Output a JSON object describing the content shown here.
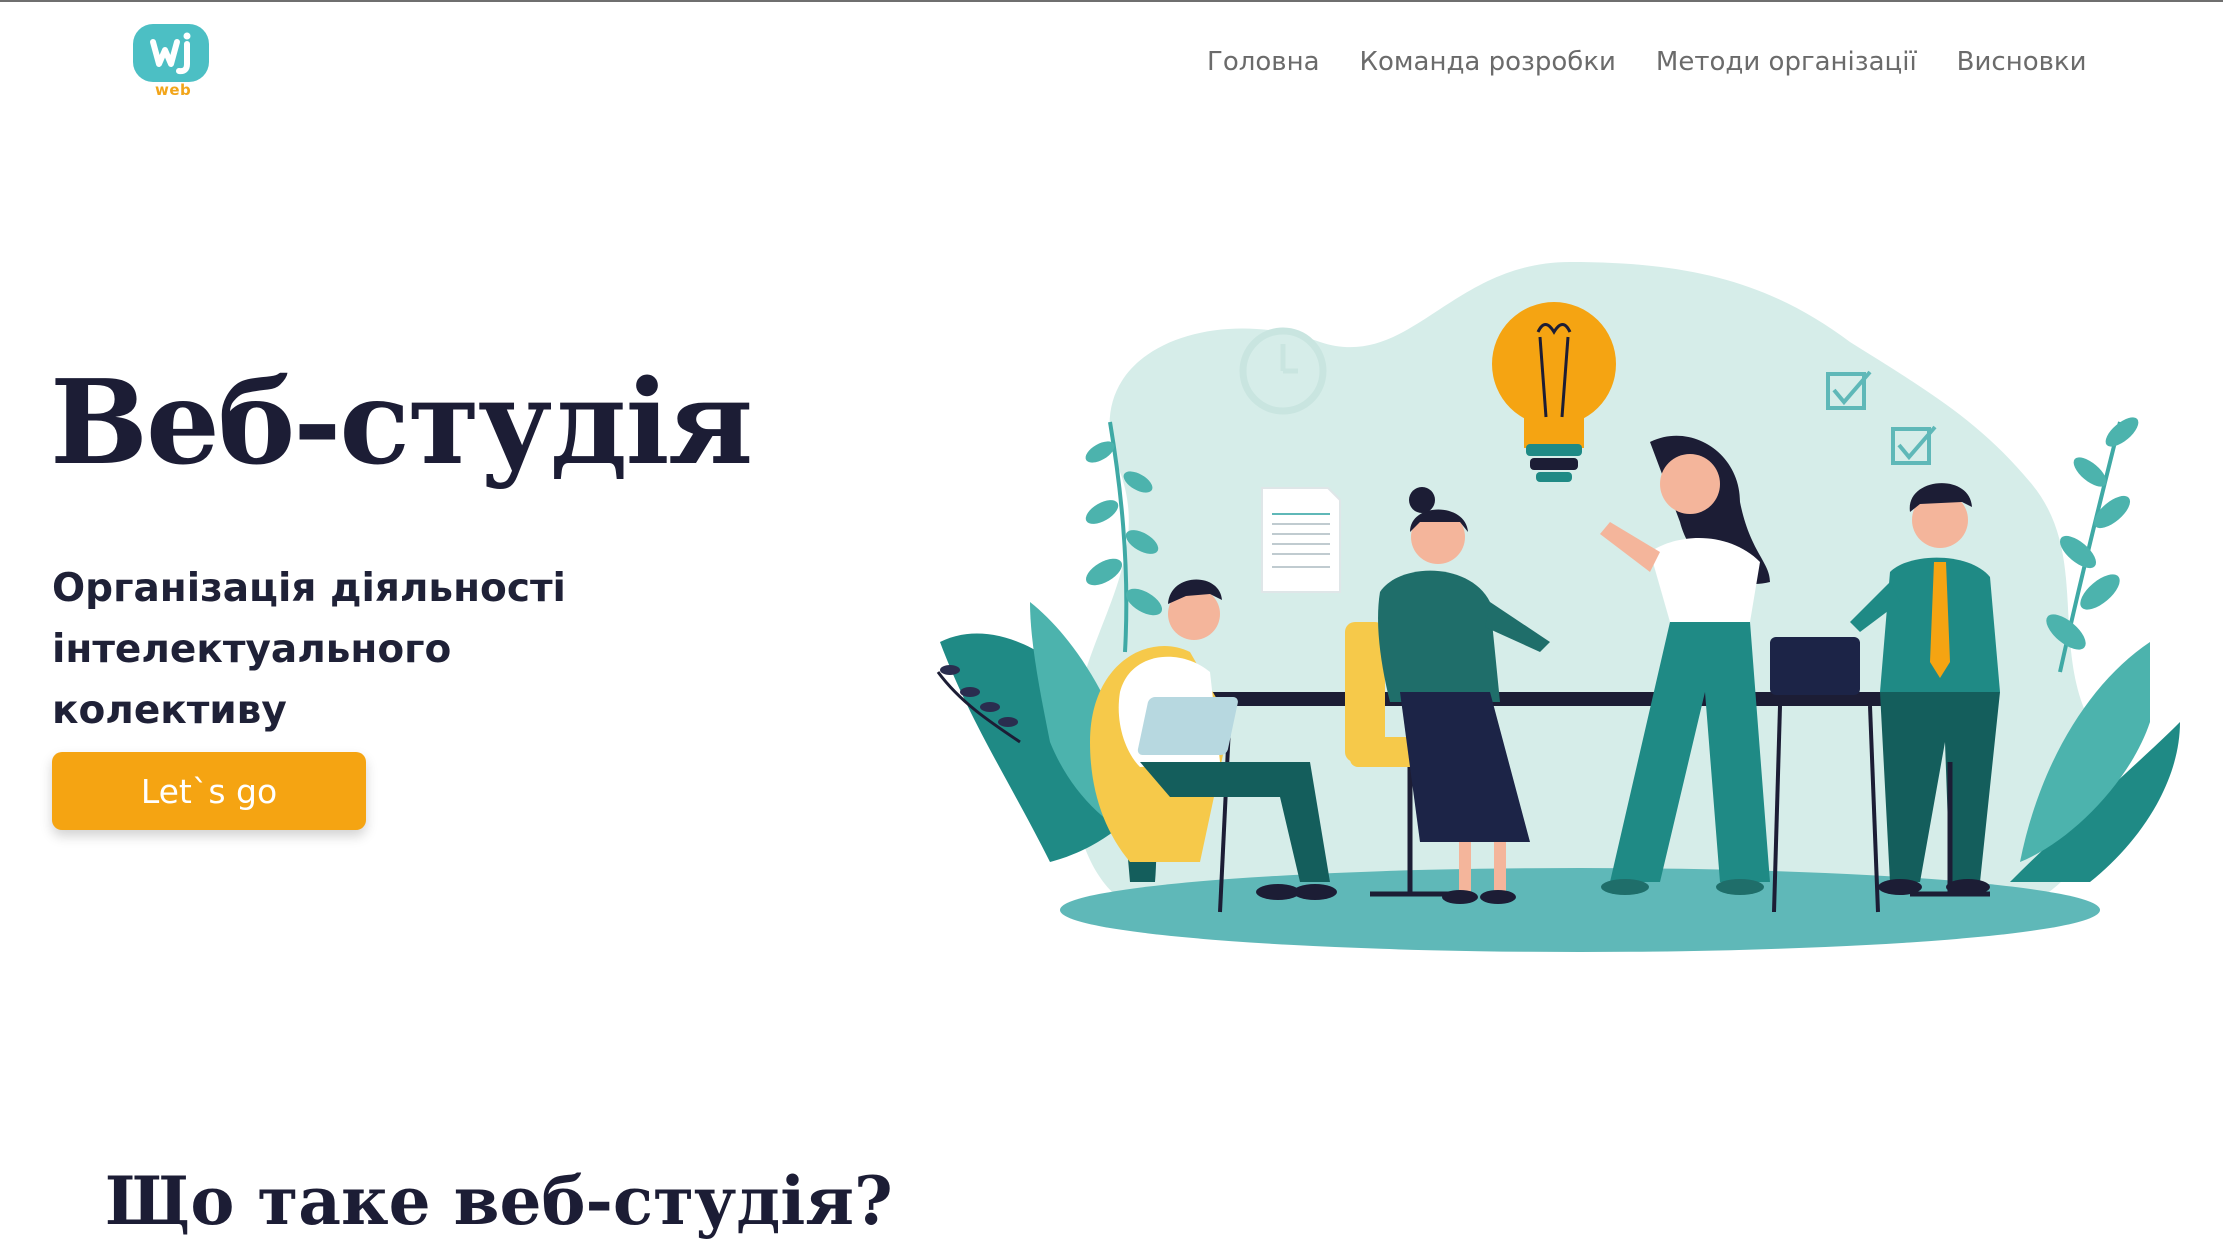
{
  "logo": {
    "text": "web",
    "colors": {
      "badge": "#4cbfc4",
      "text": "#f2a51a"
    }
  },
  "nav": {
    "items": [
      "Головна",
      "Команда розробки",
      "Методи організації",
      "Висновки"
    ]
  },
  "hero": {
    "title": "Веб-студія",
    "subtitle_line1": "Організація діяльності",
    "subtitle_line2": "інтелектуального колективу",
    "cta_label": "Let`s go"
  },
  "section": {
    "title": "Що таке веб-студія?"
  },
  "colors": {
    "accent": "#f5a412",
    "dark": "#1c1d35",
    "teal": "#1f8a85"
  }
}
